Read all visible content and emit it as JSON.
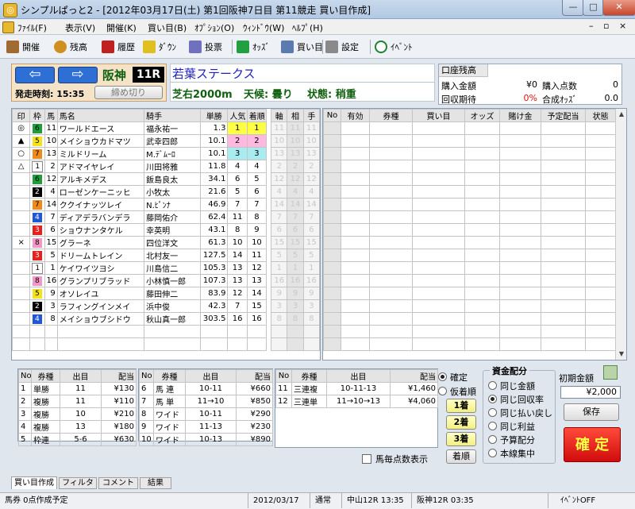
{
  "window": {
    "title": "シンプルぱっと2 - [2012年03月17日(土) 第1回阪神7日目 第11競走 買い目作成]"
  },
  "menu": [
    "ﾌｧｲﾙ(F)",
    "表示(V)",
    "開催(K)",
    "買い目(B)",
    "ｵﾌﾟｼｮﾝ(O)",
    "ｳｨﾝﾄﾞｳ(W)",
    "ﾍﾙﾌﾟ(H)"
  ],
  "toolbar": [
    "開催",
    "残高",
    "履歴",
    "ﾀﾞｳﾝ",
    "投票",
    "ｵｯｽﾞ",
    "買い目",
    "設定",
    "ｲﾍﾞﾝﾄ"
  ],
  "race": {
    "venue": "阪神",
    "race_no": "11R",
    "start_time": "発走時刻: 15:35",
    "deadline_button": "締め切り",
    "name": "若葉ステークス",
    "course": "芝右2000m",
    "weather": "天候: 曇り",
    "track": "状態: 稍重"
  },
  "account": {
    "header": "口座残高",
    "rows": [
      {
        "l1": "購入金額",
        "v1": "¥0",
        "l2": "購入点数",
        "v2": "0"
      },
      {
        "l1": "回収期待",
        "v1": "0%",
        "l2": "合成ｵｯｽﾞ",
        "v2": "0.0"
      }
    ]
  },
  "horses": {
    "headers": [
      "印",
      "枠",
      "馬",
      "馬名",
      "騎手",
      "単勝",
      "人気",
      "着順",
      "軸",
      "相",
      "手"
    ],
    "rows": [
      {
        "mark": "◎",
        "waku": "6",
        "num": "11",
        "name": "ワールドエース",
        "jockey": "福永祐一",
        "odds": "1.3",
        "pop": "1",
        "rank": "1",
        "ai": "11",
        "bi": "11",
        "ci": "11"
      },
      {
        "mark": "▲",
        "waku": "5",
        "num": "10",
        "name": "メイショウカドマツ",
        "jockey": "武幸四郎",
        "odds": "10.1",
        "pop": "2",
        "rank": "2",
        "ai": "10",
        "bi": "10",
        "ci": "10"
      },
      {
        "mark": "○",
        "waku": "7",
        "num": "13",
        "name": "ミルドリーム",
        "jockey": "M.ﾃﾞﾑｰﾛ",
        "odds": "10.1",
        "pop": "3",
        "rank": "3",
        "ai": "13",
        "bi": "13",
        "ci": "13"
      },
      {
        "mark": "△",
        "waku": "1",
        "num": "2",
        "name": "アドマイヤレイ",
        "jockey": "川田将雅",
        "odds": "11.8",
        "pop": "4",
        "rank": "4",
        "ai": "2",
        "bi": "2",
        "ci": "2"
      },
      {
        "mark": "",
        "waku": "6",
        "num": "12",
        "name": "アルキメデス",
        "jockey": "飯島良太",
        "odds": "34.1",
        "pop": "6",
        "rank": "5",
        "ai": "12",
        "bi": "12",
        "ci": "12"
      },
      {
        "mark": "",
        "waku": "2",
        "num": "4",
        "name": "ローゼンケーニッヒ",
        "jockey": "小牧太",
        "odds": "21.6",
        "pop": "5",
        "rank": "6",
        "ai": "4",
        "bi": "4",
        "ci": "4"
      },
      {
        "mark": "",
        "waku": "7",
        "num": "14",
        "name": "ククイナッツレイ",
        "jockey": "N.ﾋﾟﾝﾅ",
        "odds": "46.9",
        "pop": "7",
        "rank": "7",
        "ai": "14",
        "bi": "14",
        "ci": "14"
      },
      {
        "mark": "",
        "waku": "4",
        "num": "7",
        "name": "ディアデラバンデラ",
        "jockey": "藤岡佑介",
        "odds": "62.4",
        "pop": "11",
        "rank": "8",
        "ai": "7",
        "bi": "7",
        "ci": "7"
      },
      {
        "mark": "",
        "waku": "3",
        "num": "6",
        "name": "ショウナンタケル",
        "jockey": "幸英明",
        "odds": "43.1",
        "pop": "8",
        "rank": "9",
        "ai": "6",
        "bi": "6",
        "ci": "6"
      },
      {
        "mark": "×",
        "waku": "8",
        "num": "15",
        "name": "グラーネ",
        "jockey": "四位洋文",
        "odds": "61.3",
        "pop": "10",
        "rank": "10",
        "ai": "15",
        "bi": "15",
        "ci": "15"
      },
      {
        "mark": "",
        "waku": "3",
        "num": "5",
        "name": "ドリームトレイン",
        "jockey": "北村友一",
        "odds": "127.5",
        "pop": "14",
        "rank": "11",
        "ai": "5",
        "bi": "5",
        "ci": "5"
      },
      {
        "mark": "",
        "waku": "1",
        "num": "1",
        "name": "ケイワイツヨシ",
        "jockey": "川島信二",
        "odds": "105.3",
        "pop": "13",
        "rank": "12",
        "ai": "1",
        "bi": "1",
        "ci": "1"
      },
      {
        "mark": "",
        "waku": "8",
        "num": "16",
        "name": "グランプリブラッド",
        "jockey": "小林慎一郎",
        "odds": "107.3",
        "pop": "13",
        "rank": "13",
        "ai": "16",
        "bi": "16",
        "ci": "16"
      },
      {
        "mark": "",
        "waku": "5",
        "num": "9",
        "name": "オソレイユ",
        "jockey": "藤田伸二",
        "odds": "83.9",
        "pop": "12",
        "rank": "14",
        "ai": "9",
        "bi": "9",
        "ci": "9"
      },
      {
        "mark": "",
        "waku": "2",
        "num": "3",
        "name": "ラフィングインメイ",
        "jockey": "浜中俊",
        "odds": "42.3",
        "pop": "7",
        "rank": "15",
        "ai": "3",
        "bi": "3",
        "ci": "3"
      },
      {
        "mark": "",
        "waku": "4",
        "num": "8",
        "name": "メイショウブシドウ",
        "jockey": "秋山真一郎",
        "odds": "303.5",
        "pop": "16",
        "rank": "16",
        "ai": "8",
        "bi": "8",
        "ci": "8"
      }
    ]
  },
  "bets": {
    "headers": [
      "No",
      "有効",
      "券種",
      "買い目",
      "オッズ",
      "賭け金",
      "予定配当",
      "状態"
    ]
  },
  "payouts": {
    "headers": [
      "No",
      "券種",
      "出目",
      "配当"
    ],
    "left": [
      {
        "no": "1",
        "type": "単勝",
        "combo": "11",
        "pay": "¥130"
      },
      {
        "no": "2",
        "type": "複勝",
        "combo": "11",
        "pay": "¥110"
      },
      {
        "no": "3",
        "type": "複勝",
        "combo": "10",
        "pay": "¥210"
      },
      {
        "no": "4",
        "type": "複勝",
        "combo": "13",
        "pay": "¥180"
      },
      {
        "no": "5",
        "type": "枠連",
        "combo": "5-6",
        "pay": "¥630"
      }
    ],
    "mid": [
      {
        "no": "6",
        "type": "馬 連",
        "combo": "10-11",
        "pay": "¥660"
      },
      {
        "no": "7",
        "type": "馬 単",
        "combo": "11→10",
        "pay": "¥850"
      },
      {
        "no": "8",
        "type": "ワイド",
        "combo": "10-11",
        "pay": "¥290"
      },
      {
        "no": "9",
        "type": "ワイド",
        "combo": "11-13",
        "pay": "¥230"
      },
      {
        "no": "10",
        "type": "ワイド",
        "combo": "10-13",
        "pay": "¥890"
      }
    ],
    "right": [
      {
        "no": "11",
        "type": "三連複",
        "combo": "10-11-13",
        "pay": "¥1,460"
      },
      {
        "no": "12",
        "type": "三連単",
        "combo": "11→10→13",
        "pay": "¥4,060"
      }
    ],
    "confirm_label": "確定",
    "provisional_label": "仮着順",
    "place_buttons": [
      "1着",
      "2着",
      "3着",
      "着順"
    ],
    "checkbox_label": "馬毎点数表示"
  },
  "funds": {
    "title": "資金配分",
    "options": [
      "同じ金額",
      "同じ回収率",
      "同じ払い戻し",
      "同じ利益",
      "予算配分",
      "本線集中"
    ],
    "selected": 1,
    "initial_label": "初期金額",
    "initial_value": "¥2,000",
    "save_label": "保存",
    "confirm_label": "確 定"
  },
  "tabs": [
    "買い目作成",
    "フィルタ",
    "コメント",
    "結果"
  ],
  "status": [
    "馬券 0点作成予定",
    "2012/03/17",
    "通常",
    "中山12R 13:35",
    "阪神12R 03:35",
    "ｲﾍﾞﾝﾄOFF"
  ],
  "colors": {
    "waku": {
      "1": "#ffffff",
      "2": "#000000",
      "3": "#e8201c",
      "4": "#1f57d6",
      "5": "#f4e21a",
      "6": "#1e9e3a",
      "7": "#f08a1a",
      "8": "#f497c6"
    },
    "waku_text": {
      "1": "#000000",
      "2": "#ffffff",
      "3": "#ffffff",
      "4": "#ffffff",
      "5": "#000000",
      "6": "#000000",
      "7": "#000000",
      "8": "#000000"
    },
    "pop_cells": [
      "#ffff44",
      "#ffb8e0",
      "#a8ecf0"
    ],
    "confirm_bg": "#e81818",
    "confirm_text": "#ffff44",
    "race_name": "#2020c0",
    "race_info": "#106010"
  }
}
